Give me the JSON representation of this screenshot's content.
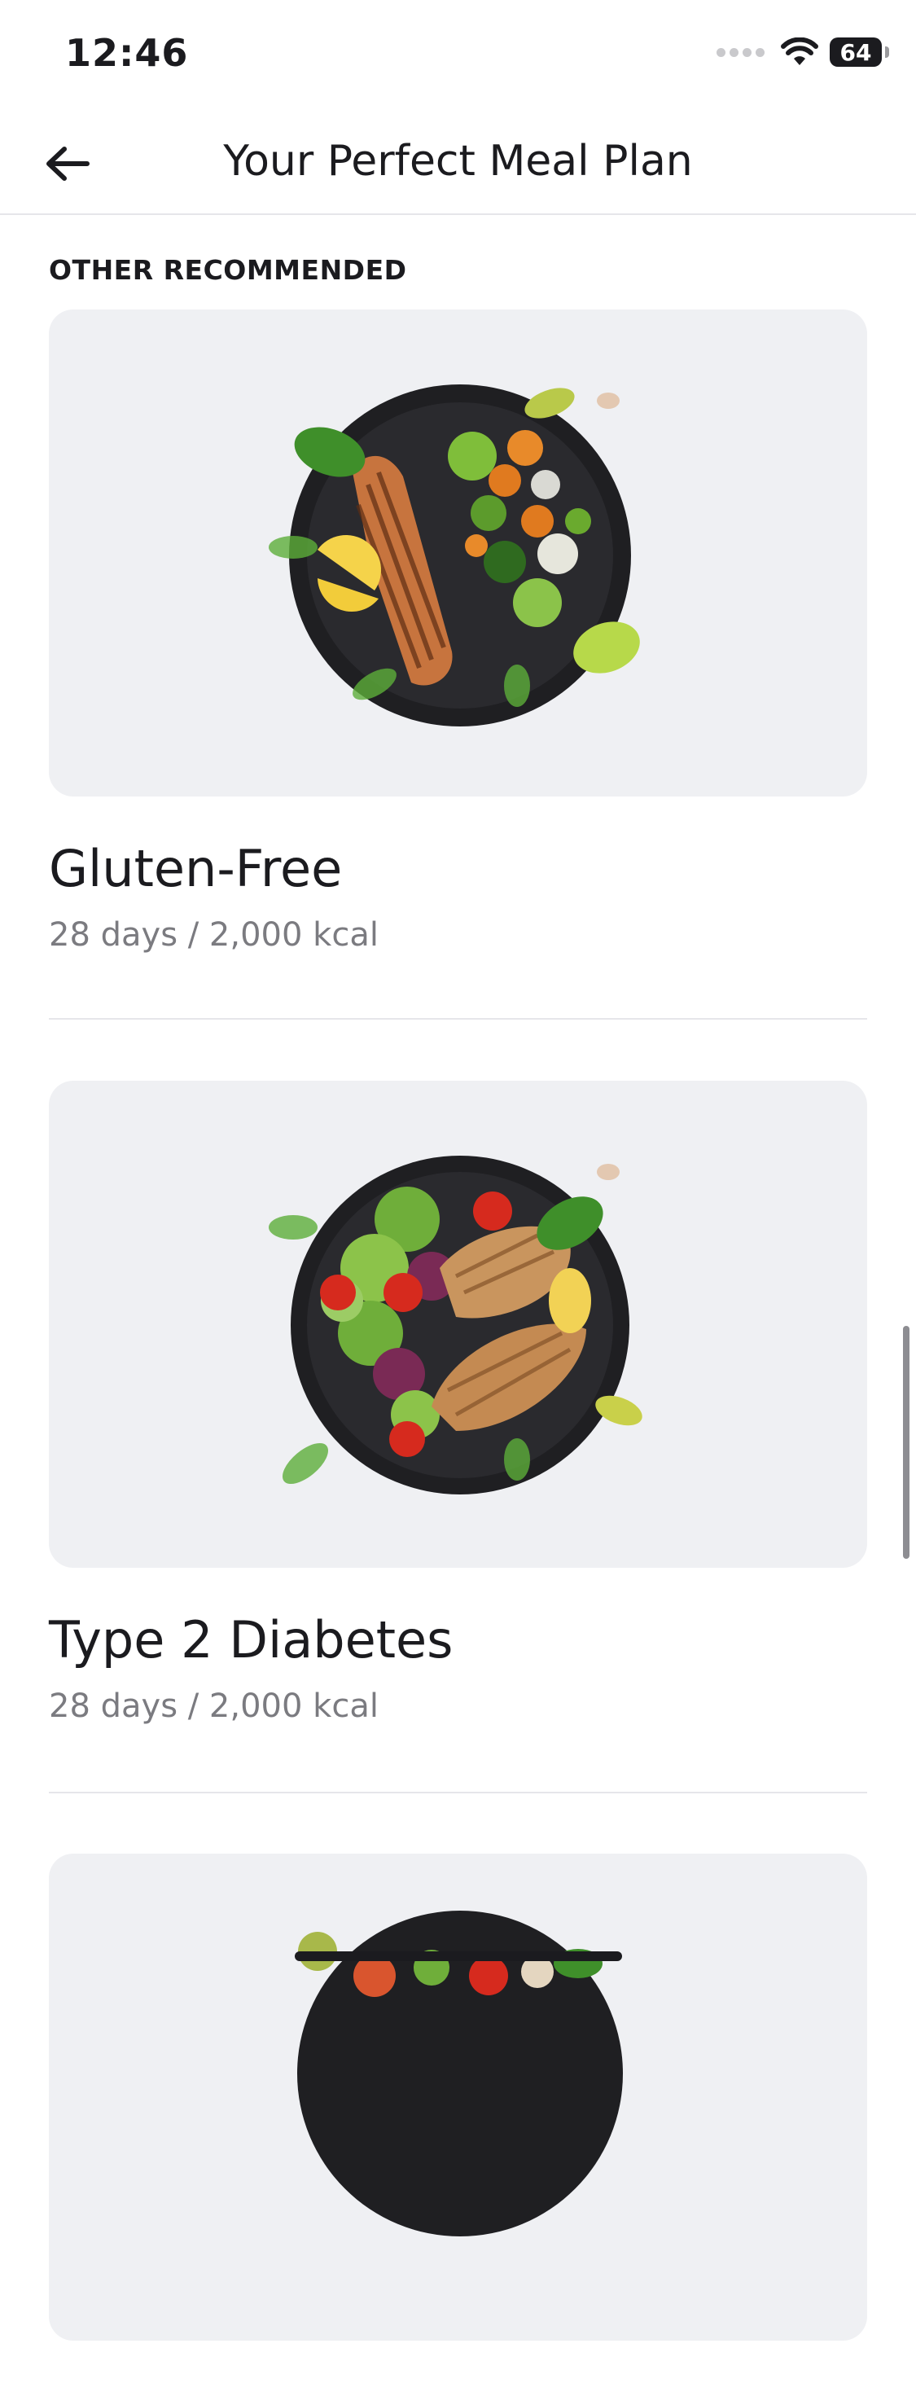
{
  "status_bar": {
    "time": "12:46",
    "battery": "64"
  },
  "header": {
    "title": "Your Perfect Meal Plan",
    "back_icon": "arrow-left-icon"
  },
  "section": {
    "label": "OTHER RECOMMENDED"
  },
  "plans": [
    {
      "title": "Gluten-Free",
      "meta": "28 days / 2,000 kcal",
      "image": "salmon-vegetables-plate"
    },
    {
      "title": "Type 2 Diabetes",
      "meta": "28 days / 2,000 kcal",
      "image": "grilled-chicken-salad-plate"
    },
    {
      "title": "",
      "meta": "",
      "image": "salad-bowl-plate"
    }
  ],
  "colors": {
    "card_bg": "#eff0f3",
    "text_primary": "#1b1b1f",
    "text_secondary": "#7b7b80",
    "divider": "#e6e6ea"
  }
}
